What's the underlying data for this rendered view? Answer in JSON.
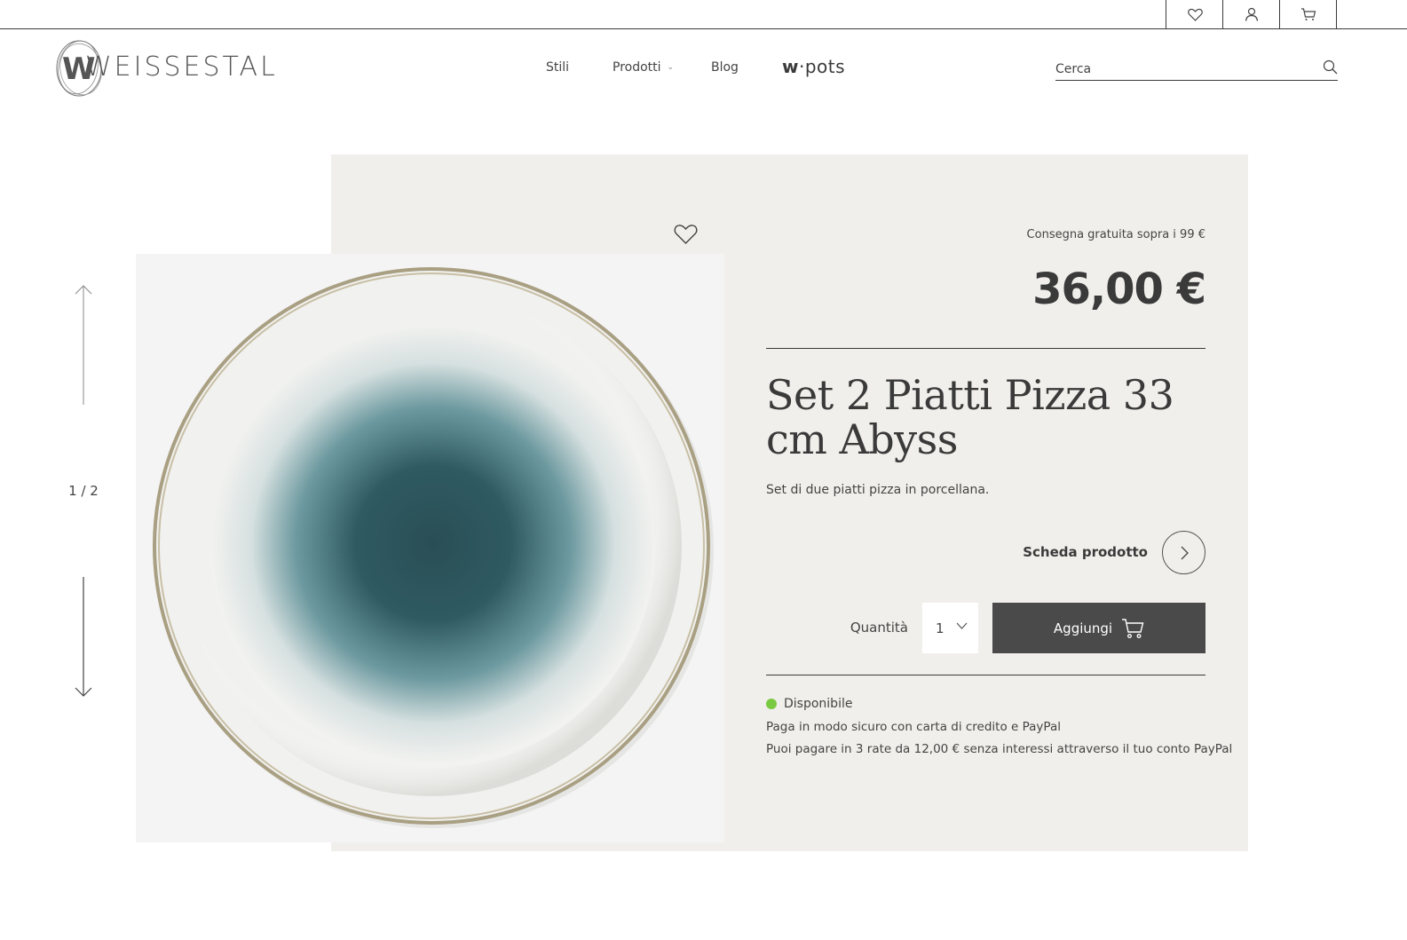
{
  "brand": {
    "name": "WEISSESTAL"
  },
  "topbar": {
    "icons": [
      "heart-icon",
      "user-icon",
      "cart-icon"
    ]
  },
  "nav": {
    "items": [
      {
        "label": "Stili"
      },
      {
        "label": "Prodotti"
      },
      {
        "label": "Blog"
      }
    ],
    "wpots": {
      "prefix": "w",
      "suffix": "pots"
    }
  },
  "search": {
    "placeholder": "Cerca"
  },
  "gallery": {
    "counter": "1 / 2"
  },
  "product": {
    "delivery_note": "Consegna gratuita sopra i 99 €",
    "price": "36,00 €",
    "title": "Set 2 Piatti Pizza 33 cm Abyss",
    "subtitle": "Set di due piatti pizza in porcellana.",
    "sheet_label": "Scheda prodotto",
    "quantity_label": "Quantità",
    "quantity_value": "1",
    "add_label": "Aggiungi",
    "availability": "Disponibile",
    "payment_line1": "Paga in modo sicuro con carta di credito e PayPal",
    "payment_line2": "Puoi pagare in 3 rate da 12,00 € senza interessi attraverso il tuo conto PayPal"
  },
  "colors": {
    "panel_bg": "#f0efeb",
    "button_bg": "#4a4a4a",
    "available_dot": "#7ac943",
    "plate_center": "#2f5a62"
  }
}
